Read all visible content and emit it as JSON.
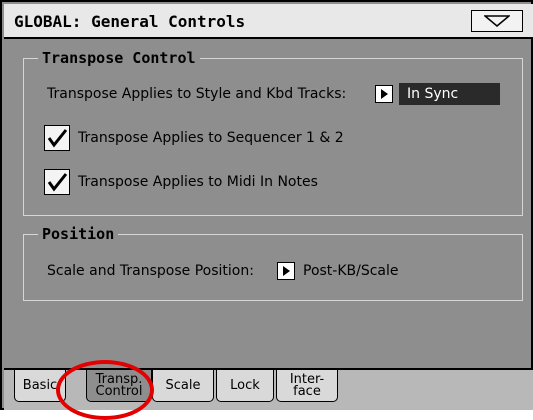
{
  "window": {
    "title": "GLOBAL: General Controls",
    "menu_icon": "triangle-down-icon"
  },
  "transpose_group": {
    "title": "Transpose Control",
    "style_kbd_label": "Transpose Applies to Style and Kbd Tracks:",
    "style_kbd_value": "In Sync",
    "sequencer_label": "Transpose Applies to Sequencer 1 & 2",
    "sequencer_checked": true,
    "midi_label": "Transpose Applies to Midi In Notes",
    "midi_checked": true
  },
  "position_group": {
    "title": "Position",
    "label": "Scale and Transpose Position:",
    "value": "Post-KB/Scale"
  },
  "tabs": [
    {
      "line1": "Basic",
      "line2": ""
    },
    {
      "line1": "Transp.",
      "line2": "Control",
      "active": true
    },
    {
      "line1": "Scale",
      "line2": ""
    },
    {
      "line1": "Lock",
      "line2": ""
    },
    {
      "line1": "Inter-",
      "line2": "face"
    }
  ],
  "colors": {
    "panel": "#8e8e8e",
    "titlebar": "#e8e8e8",
    "highlight": "#e30000"
  }
}
